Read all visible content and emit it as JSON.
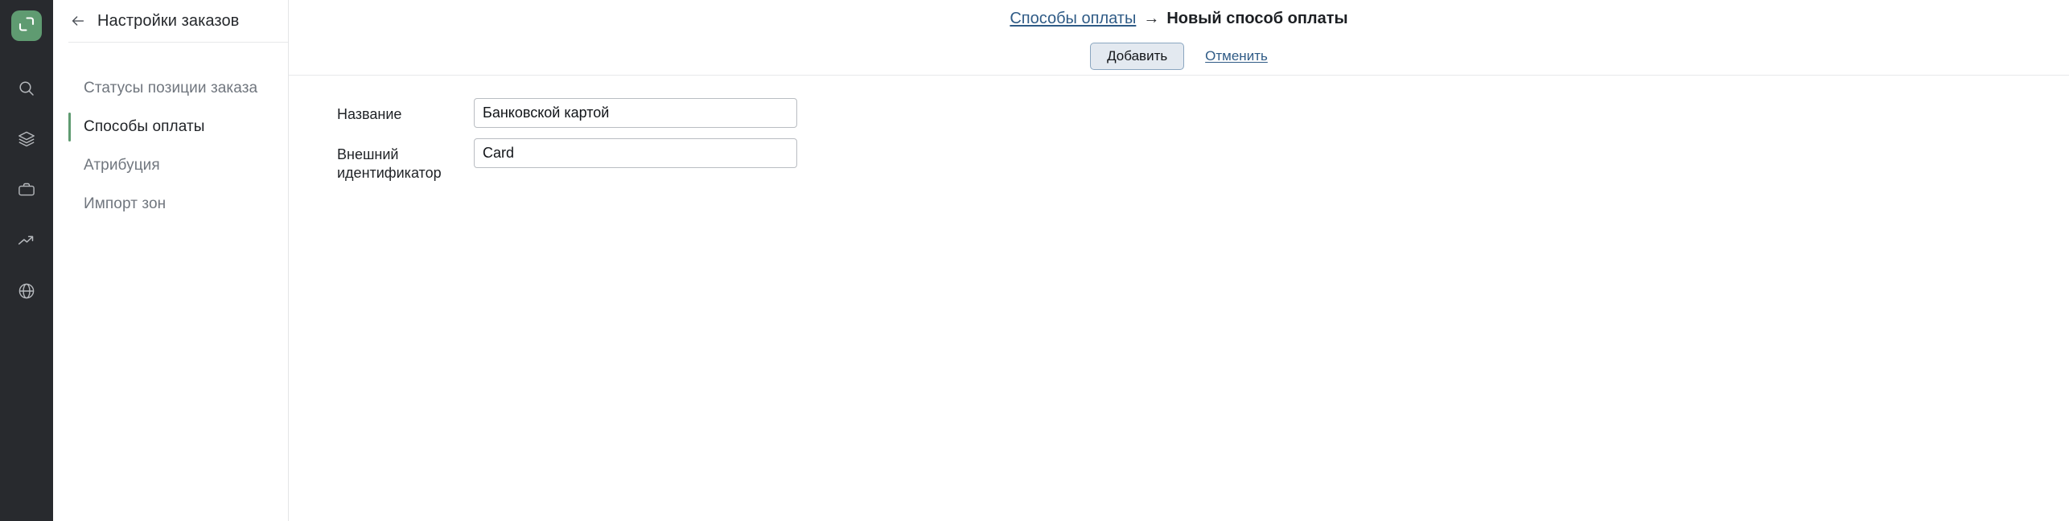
{
  "app": {
    "logo_icon": "app-logo-bracket-icon",
    "logo_color": "#5f9b71",
    "rail_background": "#282a2e"
  },
  "icon_rail": {
    "items": [
      {
        "name": "search-icon",
        "label": "Поиск"
      },
      {
        "name": "layers-icon",
        "label": "Каталог"
      },
      {
        "name": "briefcase-icon",
        "label": "Заказы"
      },
      {
        "name": "trending-up-icon",
        "label": "Аналитика"
      },
      {
        "name": "globe-icon",
        "label": "Сайт"
      }
    ]
  },
  "settings_panel": {
    "back_icon": "arrow-left-icon",
    "title": "Настройки заказов",
    "nav_items": [
      {
        "label": "Статусы позиции заказа",
        "active": false
      },
      {
        "label": "Способы оплаты",
        "active": true
      },
      {
        "label": "Атрибуция",
        "active": false
      },
      {
        "label": "Импорт зон",
        "active": false
      }
    ],
    "active_marker_color": "#5f9b71"
  },
  "main": {
    "breadcrumb": {
      "parent": "Способы оплаты",
      "separator": "→",
      "current": "Новый способ оплаты",
      "link_color": "#2f5b86"
    },
    "toolbar": {
      "submit_label": "Добавить",
      "cancel_label": "Отменить"
    },
    "form": {
      "fields": [
        {
          "label": "Название",
          "value": "Банковской картой",
          "placeholder": ""
        },
        {
          "label": "Внешний идентификатор",
          "value": "Card",
          "placeholder": ""
        }
      ]
    }
  }
}
